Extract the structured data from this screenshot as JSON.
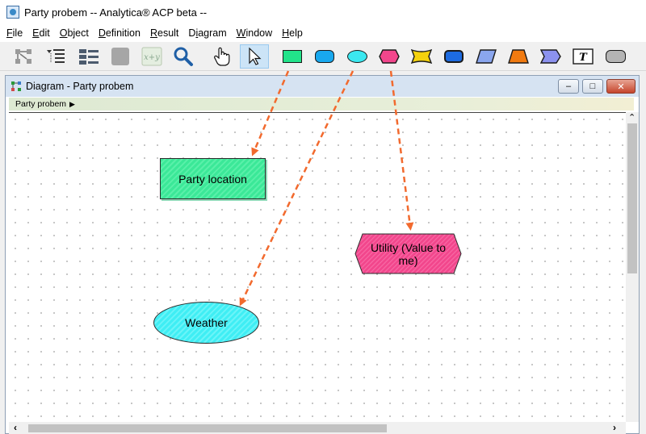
{
  "window": {
    "title": "Party probem -- Analytica® ACP beta --"
  },
  "menubar": [
    {
      "pre": "",
      "u": "F",
      "post": "ile"
    },
    {
      "pre": "",
      "u": "E",
      "post": "dit"
    },
    {
      "pre": "",
      "u": "O",
      "post": "bject"
    },
    {
      "pre": "",
      "u": "D",
      "post": "efinition"
    },
    {
      "pre": "",
      "u": "R",
      "post": "esult"
    },
    {
      "pre": "D",
      "u": "i",
      "post": "agram"
    },
    {
      "pre": "",
      "u": "W",
      "post": "indow"
    },
    {
      "pre": "",
      "u": "H",
      "post": "elp"
    }
  ],
  "toolbar": {
    "tools": [
      "diagram-view",
      "outline-view",
      "attribute-panel",
      "object-window",
      "edit-formula",
      "find",
      "browse-hand",
      "edit-arrow",
      "decision-node",
      "general-variable-node",
      "chance-node",
      "objective-node",
      "index-node",
      "module-node",
      "constant-node",
      "function-node",
      "alias-node",
      "text-node",
      "button-node"
    ],
    "formula_label": "x+y",
    "text_tool_label": "T",
    "colors": {
      "decision": "#22e38a",
      "general": "#18a8ee",
      "chance": "#3be8f0",
      "objective": "#f2468c",
      "index": "#f5d20c",
      "module": "#1d6be0",
      "constant": "#8aa6ee",
      "function": "#f07a10",
      "alias": "#8c92ee",
      "button": "#b4b4b4"
    }
  },
  "diagram_window": {
    "title": "Diagram - Party probem",
    "breadcrumb": "Party probem",
    "controls": {
      "minimize": "–",
      "maximize": "□",
      "close": "✕"
    }
  },
  "nodes": {
    "decision": {
      "label": "Party location",
      "color": "#3be898"
    },
    "chance": {
      "label": "Weather",
      "color": "#3feef4"
    },
    "objective": {
      "label": "Utility (Value to me)",
      "color": "#f2468c"
    }
  },
  "annotation_arrow_color": "#f26a2e"
}
